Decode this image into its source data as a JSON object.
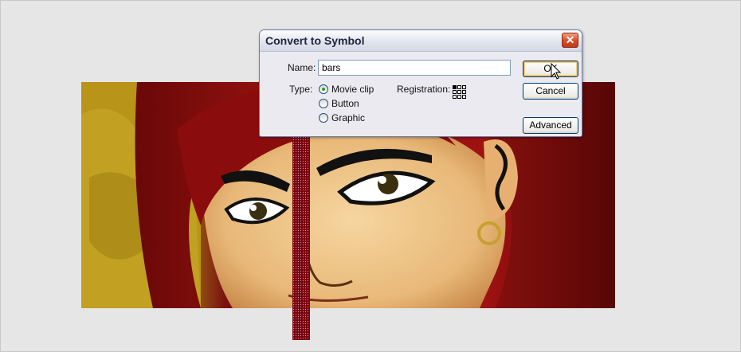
{
  "dialog": {
    "title": "Convert to Symbol",
    "close_glyph": "✕",
    "name_label": "Name:",
    "name_value": "bars",
    "type_label": "Type:",
    "types": [
      {
        "label": "Movie clip",
        "selected": true
      },
      {
        "label": "Button",
        "selected": false
      },
      {
        "label": "Graphic",
        "selected": false
      }
    ],
    "registration_label": "Registration:",
    "ok_label": "OK",
    "cancel_label": "Cancel",
    "advanced_label": "Advanced"
  },
  "colors": {
    "stage_bg": "#e6e6e6",
    "bars_fill": "#7a0010",
    "radio_dot": "#21a121",
    "close_button": "#d8502c"
  },
  "icons": [
    "close-icon",
    "registration-grid-icon",
    "mouse-cursor-icon"
  ]
}
